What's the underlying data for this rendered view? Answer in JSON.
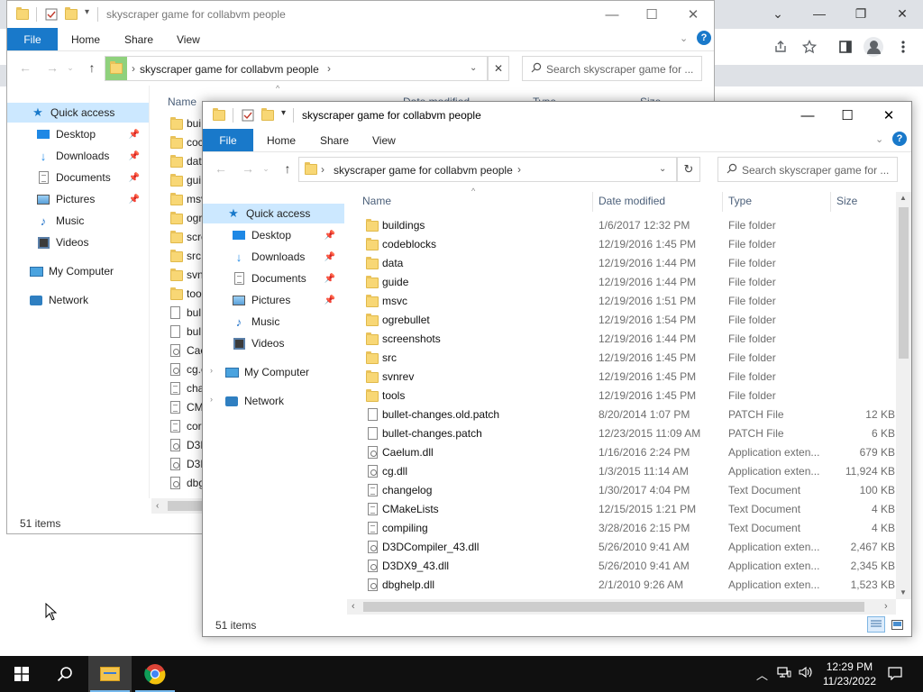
{
  "chrome": {
    "controls": [
      "⌄",
      "—",
      "❐",
      "✕"
    ],
    "toolbar_icons": [
      "share-icon",
      "star-icon",
      "sidepanel-icon",
      "profile-icon",
      "more-icon"
    ]
  },
  "window_back": {
    "title": "skyscraper game for collabvm people",
    "ribbon_tabs": {
      "file": "File",
      "home": "Home",
      "share": "Share",
      "view": "View"
    },
    "address": "skyscraper game for collabvm people",
    "search_placeholder": "Search skyscraper game for ...",
    "columns": {
      "name": "Name",
      "date": "Date modified",
      "type": "Type",
      "size": "Size"
    },
    "nav": [
      {
        "label": "Quick access"
      },
      {
        "label": "Desktop"
      },
      {
        "label": "Downloads"
      },
      {
        "label": "Documents"
      },
      {
        "label": "Pictures"
      },
      {
        "label": "Music"
      },
      {
        "label": "Videos"
      },
      {
        "label": "My Computer"
      },
      {
        "label": "Network"
      }
    ],
    "partial_names": [
      "bui",
      "coc",
      "dat",
      "gui",
      "msv",
      "ogr",
      "scre",
      "src",
      "svn",
      "too",
      "bul",
      "bul",
      "Cae",
      "cg.c",
      "cha",
      "CM",
      "cor",
      "D3D",
      "D3D",
      "dbg"
    ],
    "status": "51 items"
  },
  "window_front": {
    "title": "skyscraper game for collabvm people",
    "ribbon_tabs": {
      "file": "File",
      "home": "Home",
      "share": "Share",
      "view": "View"
    },
    "address": "skyscraper game for collabvm people",
    "search_placeholder": "Search skyscraper game for ...",
    "columns": {
      "name": "Name",
      "date": "Date modified",
      "type": "Type",
      "size": "Size"
    },
    "nav": [
      {
        "label": "Quick access"
      },
      {
        "label": "Desktop"
      },
      {
        "label": "Downloads"
      },
      {
        "label": "Documents"
      },
      {
        "label": "Pictures"
      },
      {
        "label": "Music"
      },
      {
        "label": "Videos"
      },
      {
        "label": "My Computer"
      },
      {
        "label": "Network"
      }
    ],
    "files": [
      {
        "name": "buildings",
        "date": "1/6/2017 12:32 PM",
        "type": "File folder",
        "size": "",
        "icon": "folder"
      },
      {
        "name": "codeblocks",
        "date": "12/19/2016 1:45 PM",
        "type": "File folder",
        "size": "",
        "icon": "folder"
      },
      {
        "name": "data",
        "date": "12/19/2016 1:44 PM",
        "type": "File folder",
        "size": "",
        "icon": "folder"
      },
      {
        "name": "guide",
        "date": "12/19/2016 1:44 PM",
        "type": "File folder",
        "size": "",
        "icon": "folder"
      },
      {
        "name": "msvc",
        "date": "12/19/2016 1:51 PM",
        "type": "File folder",
        "size": "",
        "icon": "folder"
      },
      {
        "name": "ogrebullet",
        "date": "12/19/2016 1:54 PM",
        "type": "File folder",
        "size": "",
        "icon": "folder"
      },
      {
        "name": "screenshots",
        "date": "12/19/2016 1:44 PM",
        "type": "File folder",
        "size": "",
        "icon": "folder"
      },
      {
        "name": "src",
        "date": "12/19/2016 1:45 PM",
        "type": "File folder",
        "size": "",
        "icon": "folder"
      },
      {
        "name": "svnrev",
        "date": "12/19/2016 1:45 PM",
        "type": "File folder",
        "size": "",
        "icon": "folder"
      },
      {
        "name": "tools",
        "date": "12/19/2016 1:45 PM",
        "type": "File folder",
        "size": "",
        "icon": "folder"
      },
      {
        "name": "bullet-changes.old.patch",
        "date": "8/20/2014 1:07 PM",
        "type": "PATCH File",
        "size": "12 KB",
        "icon": "doc"
      },
      {
        "name": "bullet-changes.patch",
        "date": "12/23/2015 11:09 AM",
        "type": "PATCH File",
        "size": "6 KB",
        "icon": "doc"
      },
      {
        "name": "Caelum.dll",
        "date": "1/16/2016 2:24 PM",
        "type": "Application exten...",
        "size": "679 KB",
        "icon": "dll"
      },
      {
        "name": "cg.dll",
        "date": "1/3/2015 11:14 AM",
        "type": "Application exten...",
        "size": "11,924 KB",
        "icon": "dll"
      },
      {
        "name": "changelog",
        "date": "1/30/2017 4:04 PM",
        "type": "Text Document",
        "size": "100 KB",
        "icon": "txt"
      },
      {
        "name": "CMakeLists",
        "date": "12/15/2015 1:21 PM",
        "type": "Text Document",
        "size": "4 KB",
        "icon": "txt"
      },
      {
        "name": "compiling",
        "date": "3/28/2016 2:15 PM",
        "type": "Text Document",
        "size": "4 KB",
        "icon": "txt"
      },
      {
        "name": "D3DCompiler_43.dll",
        "date": "5/26/2010 9:41 AM",
        "type": "Application exten...",
        "size": "2,467 KB",
        "icon": "dll"
      },
      {
        "name": "D3DX9_43.dll",
        "date": "5/26/2010 9:41 AM",
        "type": "Application exten...",
        "size": "2,345 KB",
        "icon": "dll"
      },
      {
        "name": "dbghelp.dll",
        "date": "2/1/2010 9:26 AM",
        "type": "Application exten...",
        "size": "1,523 KB",
        "icon": "dll"
      }
    ],
    "status": "51 items"
  },
  "taskbar": {
    "time": "12:29 PM",
    "date": "11/23/2022"
  },
  "colors": {
    "accent": "#1979ca",
    "selection": "#cce8ff",
    "folder": "#f8d775",
    "taskbar": "#101010"
  }
}
